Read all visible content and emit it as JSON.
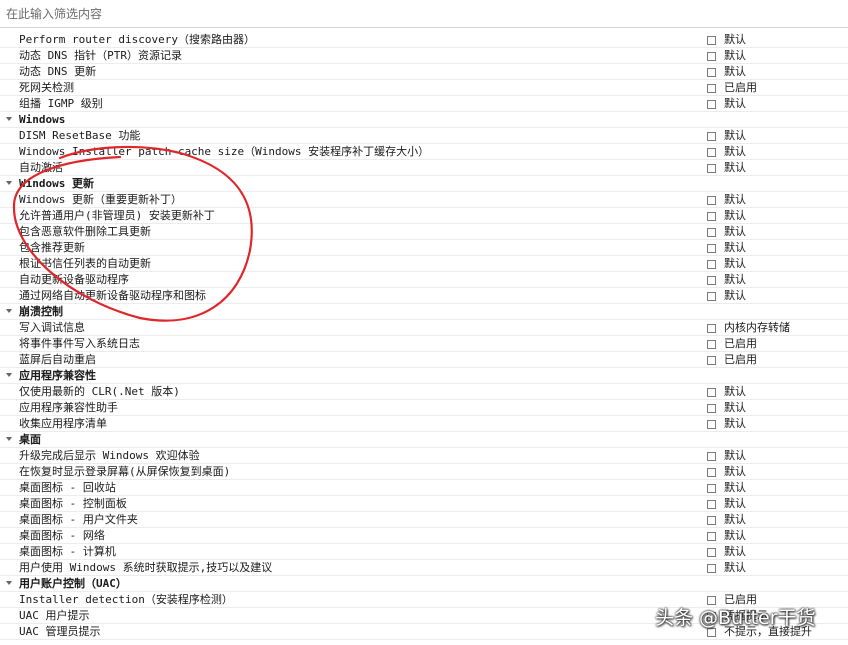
{
  "filter": {
    "placeholder": "在此输入筛选内容"
  },
  "rows": [
    {
      "type": "item",
      "label": "Perform router discovery（搜索路由器）",
      "value": "默认"
    },
    {
      "type": "item",
      "label": "动态 DNS 指针（PTR）资源记录",
      "value": "默认"
    },
    {
      "type": "item",
      "label": "动态 DNS 更新",
      "value": "默认"
    },
    {
      "type": "item",
      "label": "死网关检测",
      "value": "已启用"
    },
    {
      "type": "item",
      "label": "组播 IGMP 级别",
      "value": "默认"
    },
    {
      "type": "group",
      "label": "Windows"
    },
    {
      "type": "item",
      "label": "DISM ResetBase 功能",
      "value": "默认"
    },
    {
      "type": "item",
      "label": "Windows Installer patch cache size（Windows 安装程序补丁缓存大小）",
      "value": "默认"
    },
    {
      "type": "item",
      "label": "自动激活",
      "value": "默认"
    },
    {
      "type": "group",
      "label": "Windows 更新"
    },
    {
      "type": "item",
      "label": "Windows 更新（重要更新补丁）",
      "value": "默认"
    },
    {
      "type": "item",
      "label": "允许普通用户(非管理员) 安装更新补丁",
      "value": "默认"
    },
    {
      "type": "item",
      "label": "包含恶意软件删除工具更新",
      "value": "默认"
    },
    {
      "type": "item",
      "label": "包含推荐更新",
      "value": "默认"
    },
    {
      "type": "item",
      "label": "根证书信任列表的自动更新",
      "value": "默认"
    },
    {
      "type": "item",
      "label": "自动更新设备驱动程序",
      "value": "默认"
    },
    {
      "type": "item",
      "label": "通过网络自动更新设备驱动程序和图标",
      "value": "默认"
    },
    {
      "type": "group",
      "label": "崩溃控制"
    },
    {
      "type": "item",
      "label": "写入调试信息",
      "value": "内核内存转储"
    },
    {
      "type": "item",
      "label": "将事件事件写入系统日志",
      "value": "已启用"
    },
    {
      "type": "item",
      "label": "蓝屏后自动重启",
      "value": "已启用"
    },
    {
      "type": "group",
      "label": "应用程序兼容性"
    },
    {
      "type": "item",
      "label": "仅使用最新的 CLR(.Net 版本)",
      "value": "默认"
    },
    {
      "type": "item",
      "label": "应用程序兼容性助手",
      "value": "默认"
    },
    {
      "type": "item",
      "label": "收集应用程序清单",
      "value": "默认"
    },
    {
      "type": "group",
      "label": "桌面"
    },
    {
      "type": "item",
      "label": "升级完成后显示 Windows 欢迎体验",
      "value": "默认"
    },
    {
      "type": "item",
      "label": "在恢复时显示登录屏幕(从屏保恢复到桌面)",
      "value": "默认"
    },
    {
      "type": "item",
      "label": "桌面图标 - 回收站",
      "value": "默认"
    },
    {
      "type": "item",
      "label": "桌面图标 - 控制面板",
      "value": "默认"
    },
    {
      "type": "item",
      "label": "桌面图标 - 用户文件夹",
      "value": "默认"
    },
    {
      "type": "item",
      "label": "桌面图标 - 网络",
      "value": "默认"
    },
    {
      "type": "item",
      "label": "桌面图标 - 计算机",
      "value": "默认"
    },
    {
      "type": "item",
      "label": "用户使用 Windows 系统时获取提示,技巧以及建议",
      "value": "默认"
    },
    {
      "type": "group",
      "label": "用户账户控制（UAC）"
    },
    {
      "type": "item",
      "label": "Installer detection（安装程序检测）",
      "value": "已启用"
    },
    {
      "type": "item",
      "label": "UAC 用户提示",
      "value": "凭据提示"
    },
    {
      "type": "item",
      "label": "UAC 管理员提示",
      "value": "不提示，直接提升"
    }
  ],
  "annotation": {
    "color": "#e0262a"
  },
  "watermark": {
    "text": "头条 @Butter干货"
  }
}
